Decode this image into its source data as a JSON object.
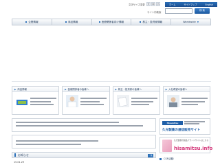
{
  "header": {
    "font_size_label": "文字サイズ変更",
    "font_sizes": [
      "大",
      "中",
      "小"
    ],
    "util_links": [
      "ホーム",
      "サイトマップ",
      "English"
    ],
    "search_label": "サイト内検索",
    "search_value": "",
    "search_button": "検 索"
  },
  "nav": {
    "items": [
      "企業情報",
      "商品情報",
      "医療関係者向け情報",
      "株主・投資家情報",
      "Worldwide"
    ]
  },
  "cards": [
    {
      "title": "商品情報",
      "text": ""
    },
    {
      "title": "医療関係者の皆様へ",
      "text": ""
    },
    {
      "title": "株主・投資家の皆様へ",
      "text": ""
    },
    {
      "title": "入社希望の皆様へ",
      "text": ""
    }
  ],
  "news": {
    "title": "お知らせ",
    "more": "一覧",
    "date": "15.01.29"
  },
  "banners": {
    "b1_logo": "Hisamitsu",
    "b1_main": "久光製薬の通信販売サイト",
    "b2_sub": "久光製薬の製品ブランドサイトはこちら",
    "b2_main": "hisamitsu.info"
  },
  "csr": {
    "label": "CSR活動"
  },
  "colors": {
    "accent": "#2a6fb8",
    "nav_text": "#233d5e",
    "brand_pink": "#d4387a"
  }
}
